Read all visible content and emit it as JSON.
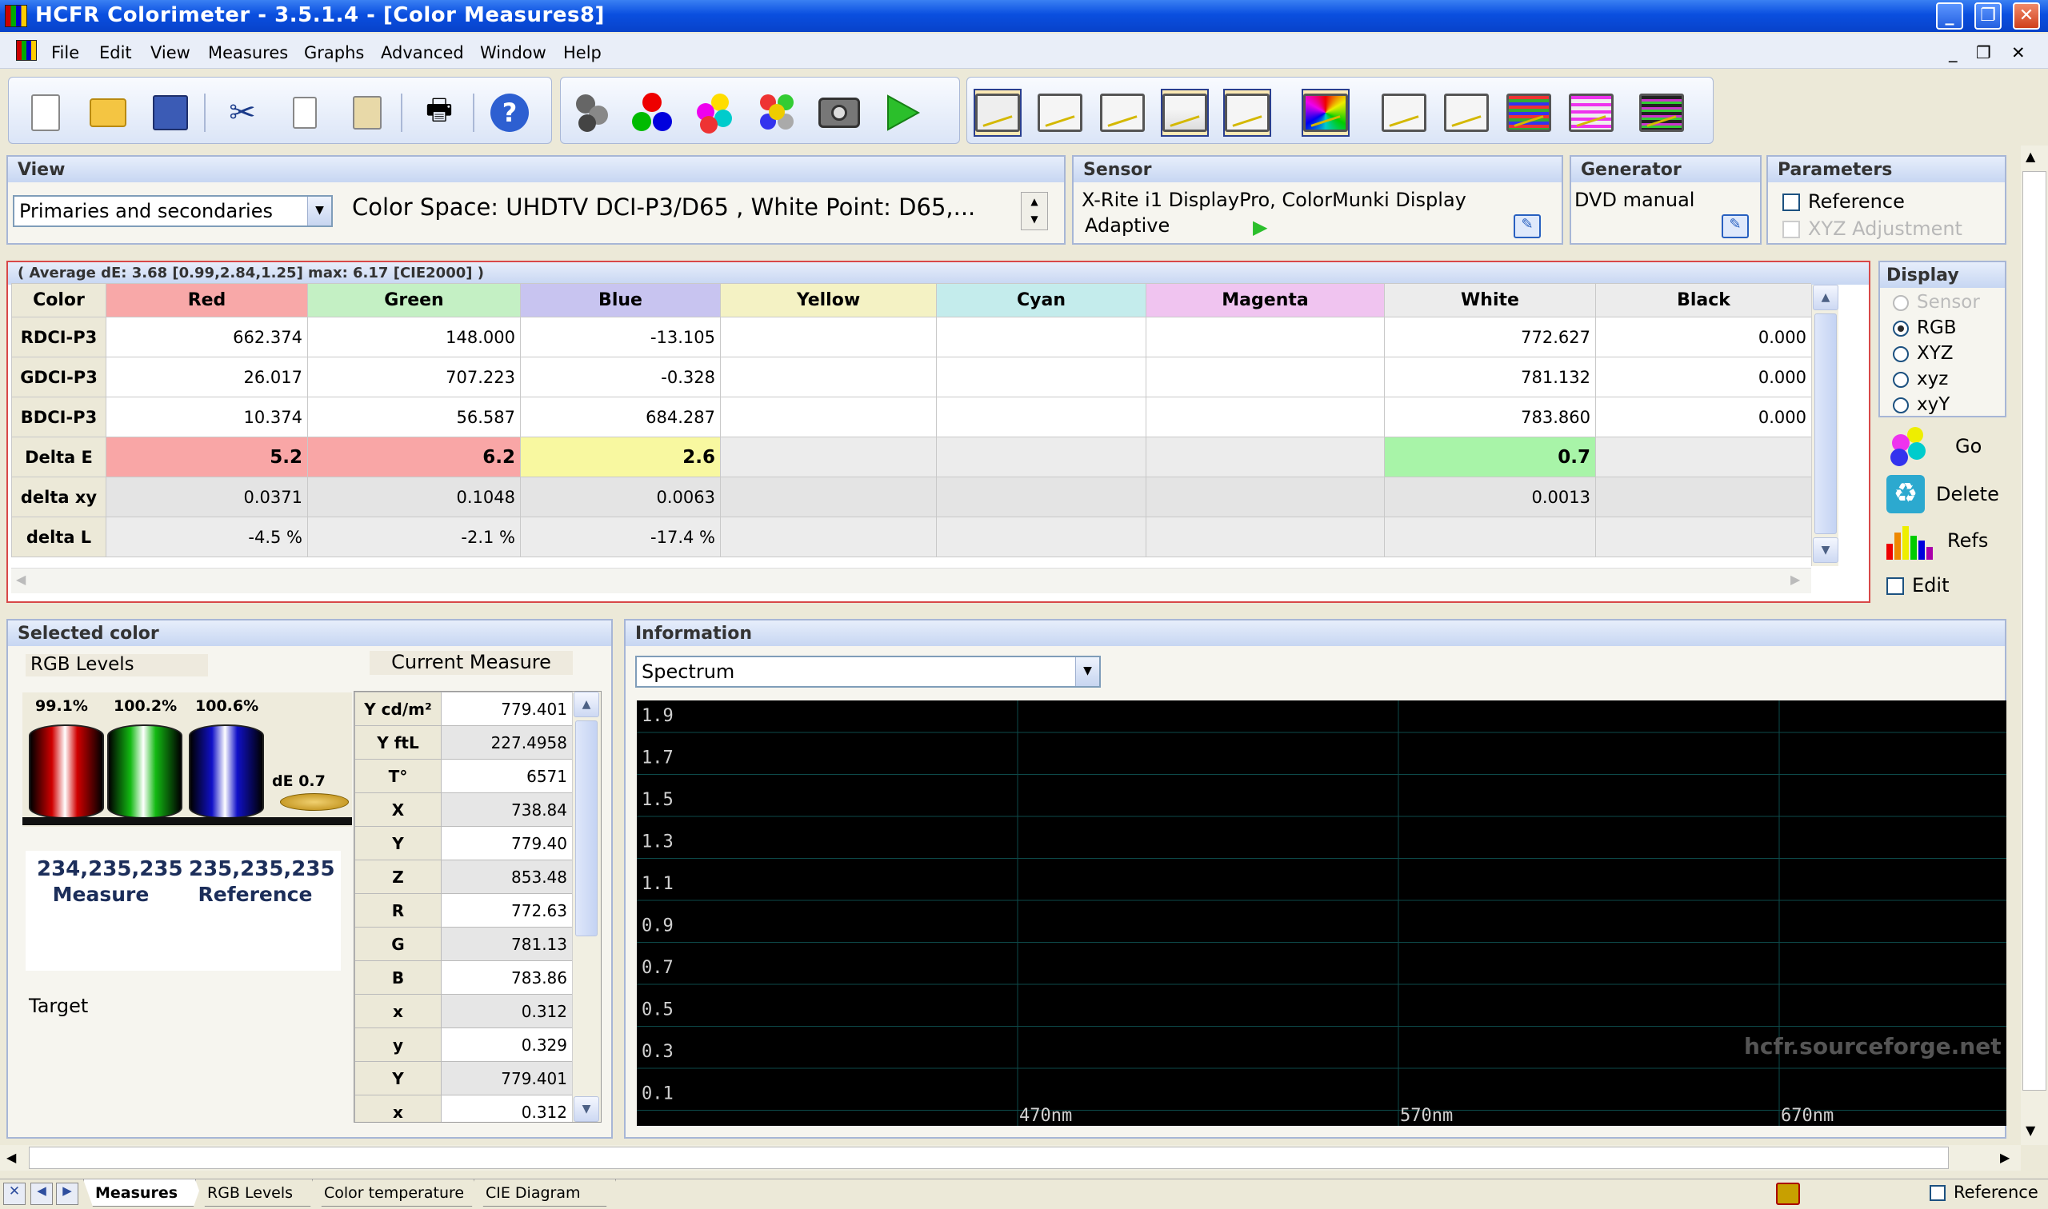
{
  "window": {
    "title": "HCFR Colorimeter - 3.5.1.4 - [Color Measures8]",
    "controls": [
      "_",
      "❐",
      "✕"
    ]
  },
  "menu": [
    "File",
    "Edit",
    "View",
    "Measures",
    "Graphs",
    "Advanced",
    "Window",
    "Help"
  ],
  "mdi_controls": [
    "_",
    "❐",
    "✕"
  ],
  "view": {
    "header": "View",
    "mode": "Primaries and secondaries",
    "colorspace": "Color Space: UHDTV DCI-P3/D65 , White Point: D65,..."
  },
  "sensor": {
    "header": "Sensor",
    "name": "X-Rite i1 DisplayPro, ColorMunki Display",
    "mode": "Adaptive"
  },
  "generator": {
    "header": "Generator",
    "name": "DVD manual"
  },
  "parameters": {
    "header": "Parameters",
    "reference": "Reference",
    "xyz": "XYZ Adjustment"
  },
  "grid": {
    "summary": "( Average dE: 3.68 [0.99,2.84,1.25] max: 6.17 [CIE2000] )",
    "columns": [
      "Color",
      "Red",
      "Green",
      "Blue",
      "Yellow",
      "Cyan",
      "Magenta",
      "White",
      "Black"
    ],
    "rows": [
      {
        "label": "RDCI-P3",
        "cells": [
          "662.374",
          "148.000",
          "-13.105",
          "",
          "",
          "",
          "772.627",
          "0.000"
        ]
      },
      {
        "label": "GDCI-P3",
        "cells": [
          "26.017",
          "707.223",
          "-0.328",
          "",
          "",
          "",
          "781.132",
          "0.000"
        ]
      },
      {
        "label": "BDCI-P3",
        "cells": [
          "10.374",
          "56.587",
          "684.287",
          "",
          "",
          "",
          "783.860",
          "0.000"
        ]
      },
      {
        "label": "Delta E",
        "cells": [
          "5.2",
          "6.2",
          "2.6",
          "",
          "",
          "",
          "0.7",
          ""
        ]
      },
      {
        "label": "delta xy",
        "cells": [
          "0.0371",
          "0.1048",
          "0.0063",
          "",
          "",
          "",
          "0.0013",
          ""
        ]
      },
      {
        "label": "delta L",
        "cells": [
          "-4.5 %",
          "-2.1 %",
          "-17.4 %",
          "",
          "",
          "",
          "",
          ""
        ]
      }
    ]
  },
  "display": {
    "header": "Display",
    "options": [
      "Sensor",
      "RGB",
      "XYZ",
      "xyz",
      "xyY"
    ],
    "selected": "RGB"
  },
  "actions": {
    "go": "Go",
    "delete": "Delete",
    "refs": "Refs",
    "edit": "Edit"
  },
  "selected": {
    "header": "Selected color",
    "rgb_levels": "RGB Levels",
    "current": "Current Measure",
    "bars": [
      {
        "label": "99.1%",
        "color": "#d00000"
      },
      {
        "label": "100.2%",
        "color": "#12b912"
      },
      {
        "label": "100.6%",
        "color": "#1010c8"
      }
    ],
    "de": "dE 0.7",
    "measure_rgb": "234,235,235",
    "measure_label": "Measure",
    "reference_rgb": "235,235,235",
    "reference_label": "Reference",
    "target": "Target"
  },
  "measures": [
    {
      "k": "Y cd/m²",
      "v": "779.401"
    },
    {
      "k": "Y ftL",
      "v": "227.4958"
    },
    {
      "k": "T°",
      "v": "6571"
    },
    {
      "k": "X",
      "v": "738.84"
    },
    {
      "k": "Y",
      "v": "779.40"
    },
    {
      "k": "Z",
      "v": "853.48"
    },
    {
      "k": "R",
      "v": "772.63"
    },
    {
      "k": "G",
      "v": "781.13"
    },
    {
      "k": "B",
      "v": "783.86"
    },
    {
      "k": "x",
      "v": "0.312"
    },
    {
      "k": "y",
      "v": "0.329"
    },
    {
      "k": "Y",
      "v": "779.401"
    },
    {
      "k": "x",
      "v": "0.312"
    }
  ],
  "information": {
    "header": "Information",
    "combo": "Spectrum",
    "watermark": "hcfr.sourceforge.net"
  },
  "chart_data": {
    "type": "line",
    "title": "",
    "y_ticks": [
      "1.9",
      "1.7",
      "1.5",
      "1.3",
      "1.1",
      "0.9",
      "0.7",
      "0.5",
      "0.3",
      "0.1"
    ],
    "x_ticks": [
      "470nm",
      "570nm",
      "670nm"
    ],
    "series": [],
    "grid": true
  },
  "tabs": [
    "Measures",
    "RGB Levels",
    "Color temperature",
    "CIE Diagram"
  ],
  "status": {
    "reference": "Reference"
  },
  "colors": {
    "red": "#f8a8a8",
    "green": "#c4f0c4",
    "blue": "#c8c4f0",
    "yellow": "#f4f2c4",
    "cyan": "#c4ecec",
    "magenta": "#f0c4f0",
    "white": "#ececec",
    "black": "#ececec",
    "de_red": "#f9a6a6",
    "de_yellow": "#f8f8a0",
    "de_green": "#a8f4a8"
  }
}
